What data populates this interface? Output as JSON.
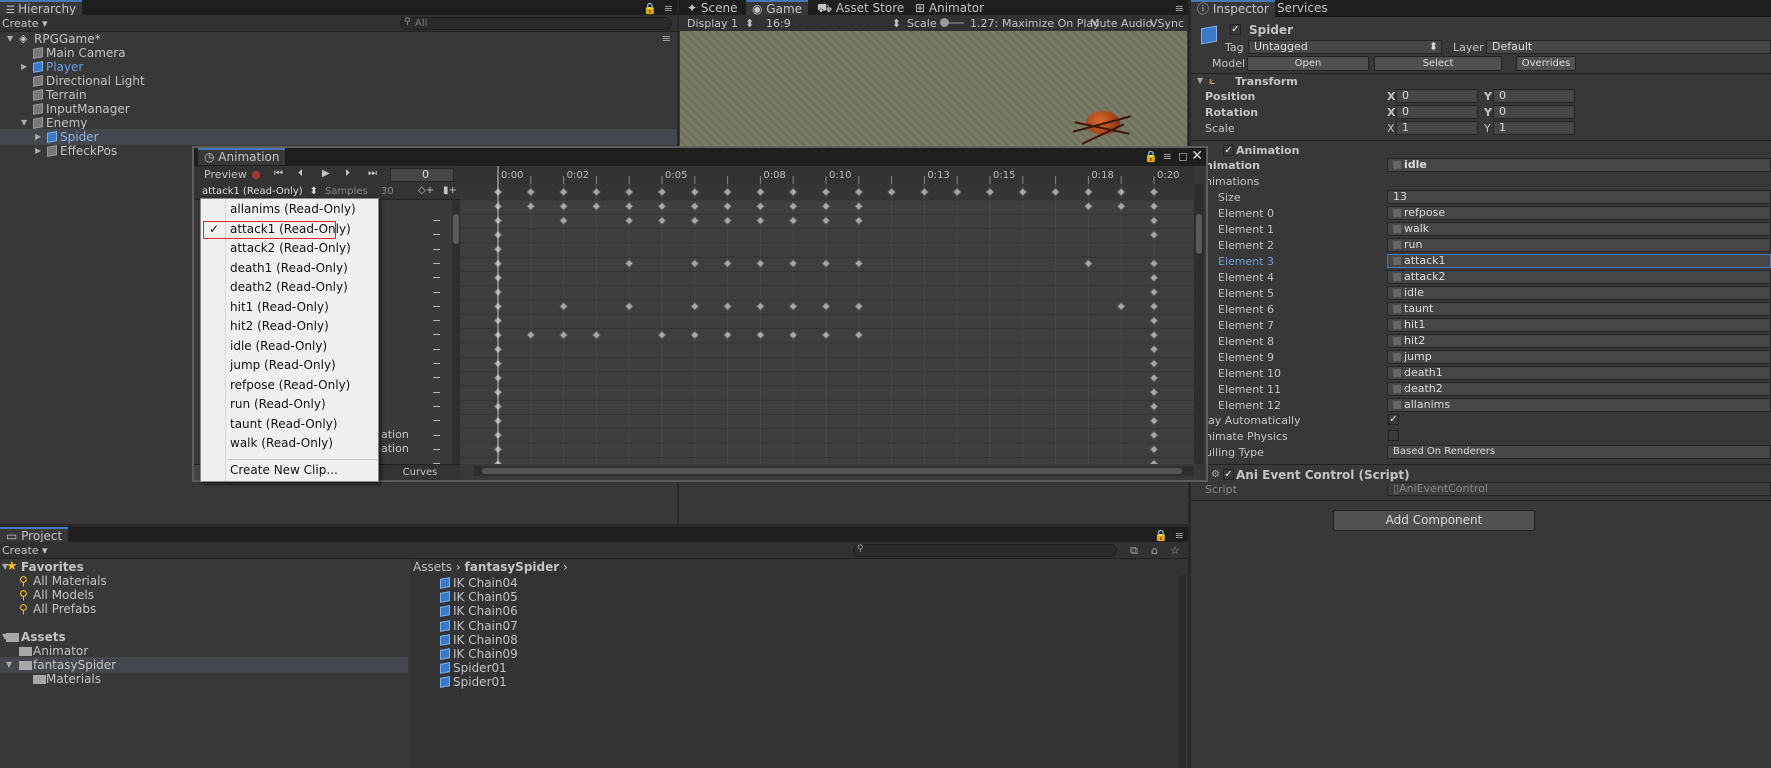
{
  "hierarchy": {
    "tab": "Hierarchy",
    "create": "Create",
    "search_placeholder": "All",
    "items": [
      {
        "label": "RPGGame*",
        "indent": 0
      },
      {
        "label": "Main Camera",
        "indent": 1
      },
      {
        "label": "Player",
        "indent": 1
      },
      {
        "label": "Directional Light",
        "indent": 1
      },
      {
        "label": "Terrain",
        "indent": 1
      },
      {
        "label": "InputManager",
        "indent": 1
      },
      {
        "label": "Enemy",
        "indent": 1
      },
      {
        "label": "Spider",
        "indent": 2
      },
      {
        "label": "EffeckPos",
        "indent": 2
      }
    ]
  },
  "scene_tabs": {
    "scene": "Scene",
    "game": "Game",
    "asset_store": "Asset Store",
    "animator": "Animator"
  },
  "game_toolbar": {
    "display": "Display 1",
    "aspect": "16:9",
    "scale_label": "Scale",
    "scale_value": "1.27:",
    "maximize": "Maximize On Play",
    "mute": "Mute Audio",
    "vsync": "VSync"
  },
  "animation": {
    "title": "Animation",
    "preview": "Preview",
    "frame": "0",
    "clip": "attack1 (Read-Only)",
    "samples_label": "Samples",
    "samples_value": "30",
    "curves": "Curves",
    "property_fragments": [
      "ation",
      "ation"
    ],
    "ruler": [
      "0:00",
      "0:02",
      "0:05",
      "0:08",
      "0:10",
      "0:13",
      "0:15",
      "0:18",
      "0:20"
    ],
    "clip_menu": [
      "allanims (Read-Only)",
      "attack1 (Read-Only)",
      "attack2 (Read-Only)",
      "death1 (Read-Only)",
      "death2 (Read-Only)",
      "hit1 (Read-Only)",
      "hit2 (Read-Only)",
      "idle (Read-Only)",
      "jump (Read-Only)",
      "refpose (Read-Only)",
      "run (Read-Only)",
      "taunt (Read-Only)",
      "walk (Read-Only)"
    ],
    "selected_clip": "attack1 (Read-Only)",
    "check_mark": "✓",
    "create_new": "Create New Clip..."
  },
  "inspector": {
    "tab": "Inspector",
    "services": "Services",
    "object_name": "Spider",
    "tag_label": "Tag",
    "tag_value": "Untagged",
    "layer_label": "Layer",
    "layer_value": "Default",
    "model_label": "Model",
    "open": "Open",
    "select": "Select",
    "overrides": "Overrides",
    "transform": {
      "title": "Transform",
      "position": "Position",
      "rotation": "Rotation",
      "scale": "Scale",
      "x": "X",
      "y": "Y",
      "pos_x": "0",
      "pos_y": "0",
      "rot_x": "0",
      "rot_y": "0",
      "scale_x": "1",
      "scale_y": "1"
    },
    "animation_comp": {
      "title": "Animation",
      "animation_label": "nimation",
      "animation_value": "idle",
      "animations_label": "nimations",
      "size_label": "Size",
      "size_value": "13",
      "elements": [
        {
          "label": "Element 0",
          "value": "refpose"
        },
        {
          "label": "Element 1",
          "value": "walk"
        },
        {
          "label": "Element 2",
          "value": "run"
        },
        {
          "label": "Element 3",
          "value": "attack1"
        },
        {
          "label": "Element 4",
          "value": "attack2"
        },
        {
          "label": "Element 5",
          "value": "idle"
        },
        {
          "label": "Element 6",
          "value": "taunt"
        },
        {
          "label": "Element 7",
          "value": "hit1"
        },
        {
          "label": "Element 8",
          "value": "hit2"
        },
        {
          "label": "Element 9",
          "value": "jump"
        },
        {
          "label": "Element 10",
          "value": "death1"
        },
        {
          "label": "Element 11",
          "value": "death2"
        },
        {
          "label": "Element 12",
          "value": "allanims"
        }
      ],
      "play_auto": "lay Automatically",
      "animate_physics": "nimate Physics",
      "culling_label": "ulling Type",
      "culling_value": "Based On Renderers"
    },
    "script_comp": {
      "title": "Ani Event Control (Script)",
      "script_label": "Script",
      "script_value": "AniEventControl"
    },
    "add_component": "Add Component"
  },
  "project": {
    "tab": "Project",
    "create": "Create",
    "favorites": "Favorites",
    "fav_items": [
      "All Materials",
      "All Models",
      "All Prefabs"
    ],
    "assets": "Assets",
    "folders": [
      "Animator",
      "fantasySpider",
      "Materials"
    ],
    "breadcrumb_root": "Assets",
    "breadcrumb_child": "fantasySpider",
    "files": [
      "IK Chain04",
      "IK Chain05",
      "IK Chain06",
      "IK Chain07",
      "IK Chain08",
      "IK Chain09",
      "Spider01",
      "Spider01"
    ]
  },
  "colors": {
    "accent_blue": "#4a78b7",
    "selection_red": "#d8282e",
    "dropdown_bg": "#f0f0f0"
  }
}
